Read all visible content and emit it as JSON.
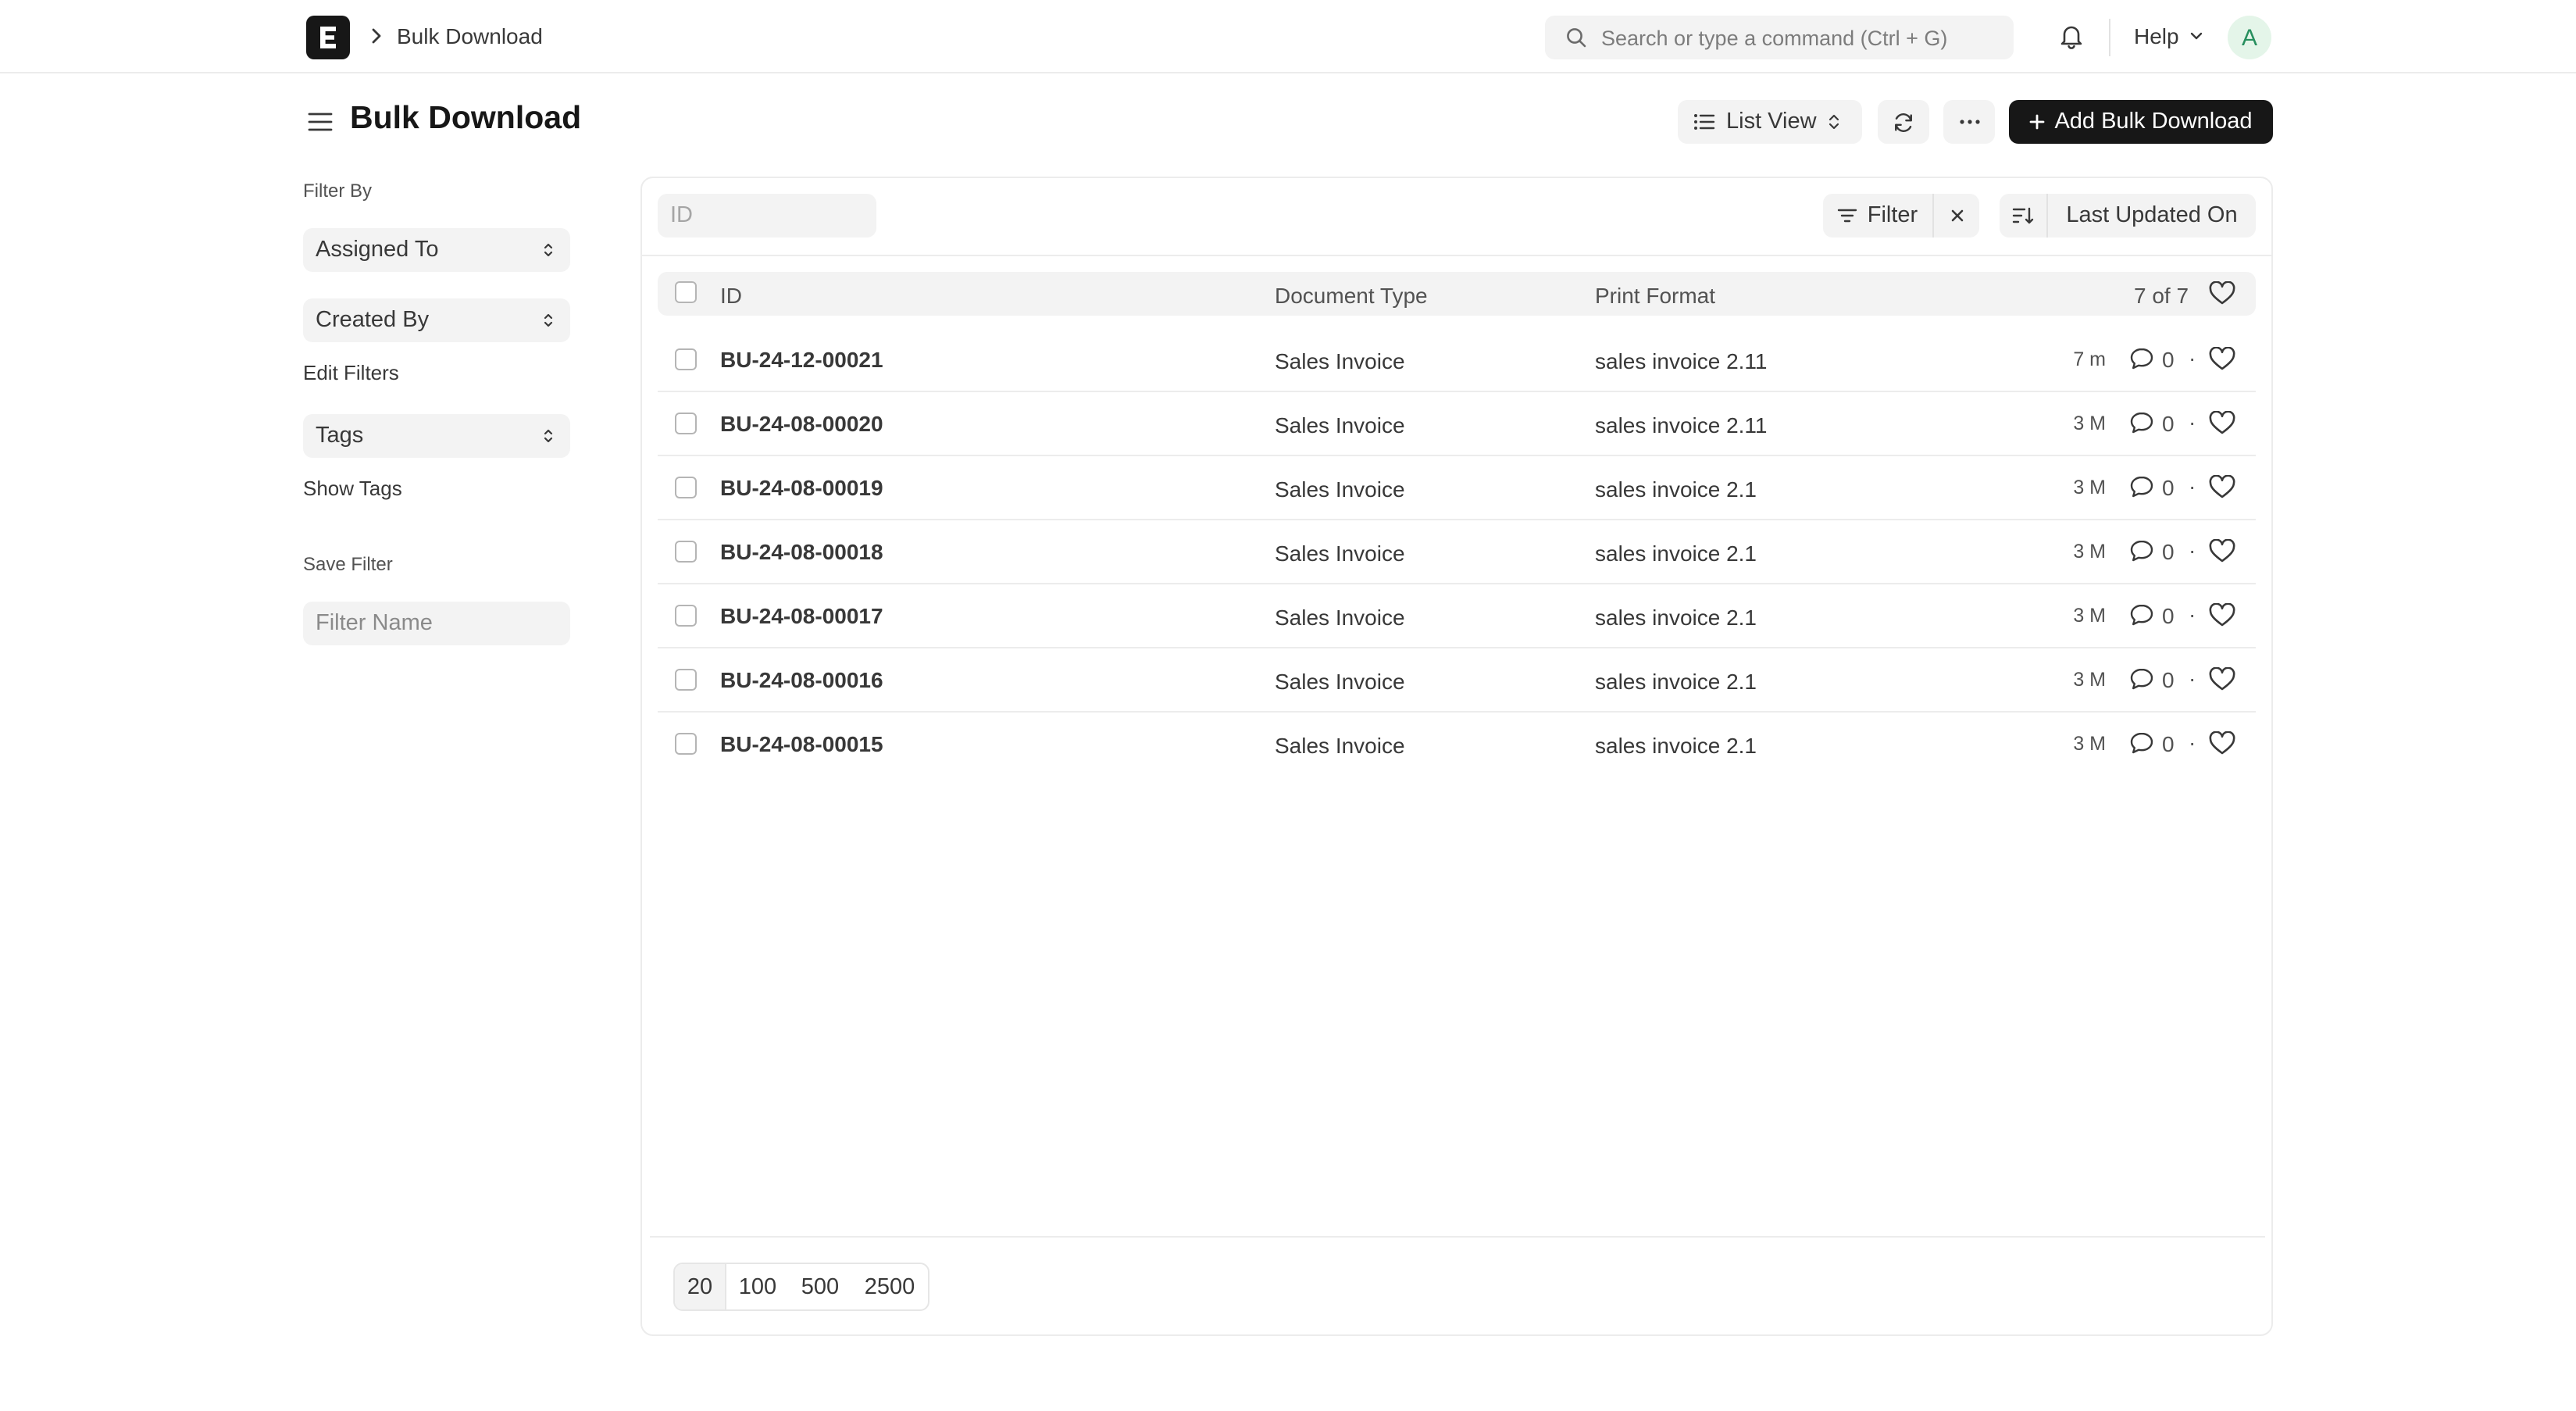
{
  "navbar": {
    "breadcrumb": "Bulk Download",
    "search_placeholder": "Search or type a command (Ctrl + G)",
    "help_label": "Help",
    "avatar_initial": "A"
  },
  "page": {
    "title": "Bulk Download",
    "view_label": "List View",
    "primary_action": "Add Bulk Download"
  },
  "sidebar": {
    "filter_by": "Filter By",
    "assigned_to": "Assigned To",
    "created_by": "Created By",
    "edit_filters": "Edit Filters",
    "tags": "Tags",
    "show_tags": "Show Tags",
    "save_filter": "Save Filter",
    "filter_name_placeholder": "Filter Name"
  },
  "toolbar": {
    "id_placeholder": "ID",
    "filter_label": "Filter",
    "sort_label": "Last Updated On"
  },
  "table": {
    "columns": [
      "ID",
      "Document Type",
      "Print Format"
    ],
    "count": "7 of 7",
    "rows": [
      {
        "id": "BU-24-12-00021",
        "doc_type": "Sales Invoice",
        "print_format": "sales invoice 2.11",
        "modified": "7 m",
        "comments": "0"
      },
      {
        "id": "BU-24-08-00020",
        "doc_type": "Sales Invoice",
        "print_format": "sales invoice 2.11",
        "modified": "3 M",
        "comments": "0"
      },
      {
        "id": "BU-24-08-00019",
        "doc_type": "Sales Invoice",
        "print_format": "sales invoice 2.1",
        "modified": "3 M",
        "comments": "0"
      },
      {
        "id": "BU-24-08-00018",
        "doc_type": "Sales Invoice",
        "print_format": "sales invoice 2.1",
        "modified": "3 M",
        "comments": "0"
      },
      {
        "id": "BU-24-08-00017",
        "doc_type": "Sales Invoice",
        "print_format": "sales invoice 2.1",
        "modified": "3 M",
        "comments": "0"
      },
      {
        "id": "BU-24-08-00016",
        "doc_type": "Sales Invoice",
        "print_format": "sales invoice 2.1",
        "modified": "3 M",
        "comments": "0"
      },
      {
        "id": "BU-24-08-00015",
        "doc_type": "Sales Invoice",
        "print_format": "sales invoice 2.1",
        "modified": "3 M",
        "comments": "0"
      }
    ]
  },
  "pagination": {
    "page_sizes": [
      "20",
      "100",
      "500",
      "2500"
    ],
    "selected": "20"
  },
  "colors": {
    "primary_button": "#171717",
    "control_bg": "#f3f3f3",
    "border": "#ececec",
    "avatar_bg": "#e4f5e9",
    "avatar_text": "#278f5e"
  },
  "icons": [
    "app-logo-icon",
    "chevron-right-icon",
    "search-icon",
    "bell-icon",
    "chevron-down-icon",
    "hamburger-icon",
    "list-icon",
    "sort-arrows-icon",
    "refresh-icon",
    "ellipsis-icon",
    "plus-icon",
    "filter-icon",
    "close-icon",
    "sort-icon",
    "comment-icon",
    "heart-icon"
  ]
}
